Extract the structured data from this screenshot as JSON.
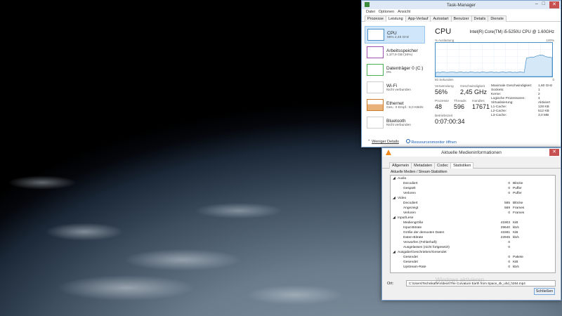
{
  "taskmanager": {
    "title": "Task-Manager",
    "menu": [
      "Datei",
      "Optionen",
      "Ansicht"
    ],
    "tabs": [
      "Prozesse",
      "Leistung",
      "App-Verlauf",
      "Autostart",
      "Benutzer",
      "Details",
      "Dienste"
    ],
    "active_tab": "Leistung",
    "sidebar": [
      {
        "name": "CPU",
        "sub": "56% 2,45 GHz",
        "color": "#4a90c8"
      },
      {
        "name": "Arbeitsspeicher",
        "sub": "1,3/7,9 GB (16%)",
        "color": "#9b4fb5"
      },
      {
        "name": "Datenträger 0 (C:)",
        "sub": "0%",
        "color": "#4caf50"
      },
      {
        "name": "Wi-Fi",
        "sub": "Nicht verbunden",
        "color": "#cccccc"
      },
      {
        "name": "Ethernet",
        "sub": "Ges.: 0 Empf.: 8,0 KBit/s",
        "color": "#c97a2a"
      },
      {
        "name": "Bluetooth",
        "sub": "Nicht verbunden",
        "color": "#cccccc"
      }
    ],
    "cpu_title": "CPU",
    "cpu_model": "Intel(R) Core(TM) i5-5250U CPU @ 1.60GHz",
    "graph_label_left": "% Auslastung",
    "graph_label_right": "100%",
    "graph_time": "60 Sekunden",
    "graph_zero": "0",
    "stats": {
      "usage_label": "Verwendung",
      "usage": "56%",
      "speed_label": "Geschwindigkeit",
      "speed": "2,45 GHz",
      "proc_label": "Prozesse",
      "proc": "48",
      "threads_label": "Threads",
      "threads": "596",
      "handles_label": "Handles",
      "handles": "17671",
      "uptime_label": "Betriebszeit",
      "uptime": "0:07:00:34"
    },
    "right_stats": [
      {
        "k": "Maximale Geschwindigkeit:",
        "v": "1,60 GHz"
      },
      {
        "k": "Sockets:",
        "v": "1"
      },
      {
        "k": "Kerne:",
        "v": "2"
      },
      {
        "k": "Logische Prozessoren:",
        "v": "4"
      },
      {
        "k": "Virtualisierung:",
        "v": "Aktiviert"
      },
      {
        "k": "L1-Cache:",
        "v": "128 KB"
      },
      {
        "k": "L2-Cache:",
        "v": "512 KB"
      },
      {
        "k": "L3-Cache:",
        "v": "3,0 MB"
      }
    ],
    "footer_less": "Weniger Details",
    "footer_monitor": "Ressourcenmonitor öffnen"
  },
  "mediainfo": {
    "title": "Aktuelle Medieninformationen",
    "tabs": [
      "Allgemein",
      "Metadaten",
      "Codec",
      "Statistiken"
    ],
    "active_tab": "Statistiken",
    "section": "Aktuelle Medien / Stream-Statistiken",
    "rows": [
      {
        "k": "Audio",
        "lvl": 0,
        "val": "",
        "unit": ""
      },
      {
        "k": "Decodiert",
        "lvl": 1,
        "val": "0",
        "unit": "Blöcke"
      },
      {
        "k": "Gespielt",
        "lvl": 1,
        "val": "0",
        "unit": "Puffer"
      },
      {
        "k": "Verloren",
        "lvl": 1,
        "val": "0",
        "unit": "Puffer"
      },
      {
        "k": "Video",
        "lvl": 0,
        "val": "",
        "unit": ""
      },
      {
        "k": "Decodiert",
        "lvl": 1,
        "val": "585",
        "unit": "Blöcke"
      },
      {
        "k": "Angezeigt",
        "lvl": 1,
        "val": "569",
        "unit": "Frames"
      },
      {
        "k": "Verloren",
        "lvl": 1,
        "val": "0",
        "unit": "Frames"
      },
      {
        "k": "Input/Lese",
        "lvl": 0,
        "val": "",
        "unit": ""
      },
      {
        "k": "Mediengröße",
        "lvl": 1,
        "val": "41903",
        "unit": "KiB"
      },
      {
        "k": "Input-Bitrate",
        "lvl": 1,
        "val": "29640",
        "unit": "kb/s"
      },
      {
        "k": "Größe der demuxten Daten",
        "lvl": 1,
        "val": "41591",
        "unit": "KiB"
      },
      {
        "k": "Daten-Bitrate",
        "lvl": 1,
        "val": "22945",
        "unit": "kb/s"
      },
      {
        "k": "Verworfen (Fehlerhaft)",
        "lvl": 1,
        "val": "0",
        "unit": ""
      },
      {
        "k": "Ausgelassen (nicht fortgesetzt)",
        "lvl": 1,
        "val": "0",
        "unit": ""
      },
      {
        "k": "Ausgabe/Geschrieben/Gesendet",
        "lvl": 0,
        "val": "",
        "unit": ""
      },
      {
        "k": "Gesendet",
        "lvl": 1,
        "val": "0",
        "unit": "Pakete"
      },
      {
        "k": "Gesendet",
        "lvl": 1,
        "val": "0",
        "unit": "KiB"
      },
      {
        "k": "Upstream-Rate",
        "lvl": 1,
        "val": "0",
        "unit": "kb/s"
      }
    ],
    "ort_label": "Ort:",
    "ort_value": "C:\\Users\\Technikaffe\\Videos\\The Curvature Earth from Space_4k_uhd_h264.mp4",
    "close_label": "Schließen",
    "watermark": "Windows aktivieren"
  },
  "graph_points": [
    0.12,
    0.13,
    0.12,
    0.14,
    0.13,
    0.12,
    0.13,
    0.14,
    0.13,
    0.12,
    0.13,
    0.14,
    0.12,
    0.13,
    0.12,
    0.14,
    0.13,
    0.12,
    0.13,
    0.12,
    0.14,
    0.13,
    0.12,
    0.13,
    0.14,
    0.12,
    0.13,
    0.12,
    0.13,
    0.14,
    0.12,
    0.13,
    0.14,
    0.12,
    0.13,
    0.12,
    0.14,
    0.13,
    0.12,
    0.55,
    0.56,
    0.58,
    0.57,
    0.6,
    0.62,
    0.64,
    0.63,
    0.6,
    0.58,
    0.57,
    0.56
  ]
}
